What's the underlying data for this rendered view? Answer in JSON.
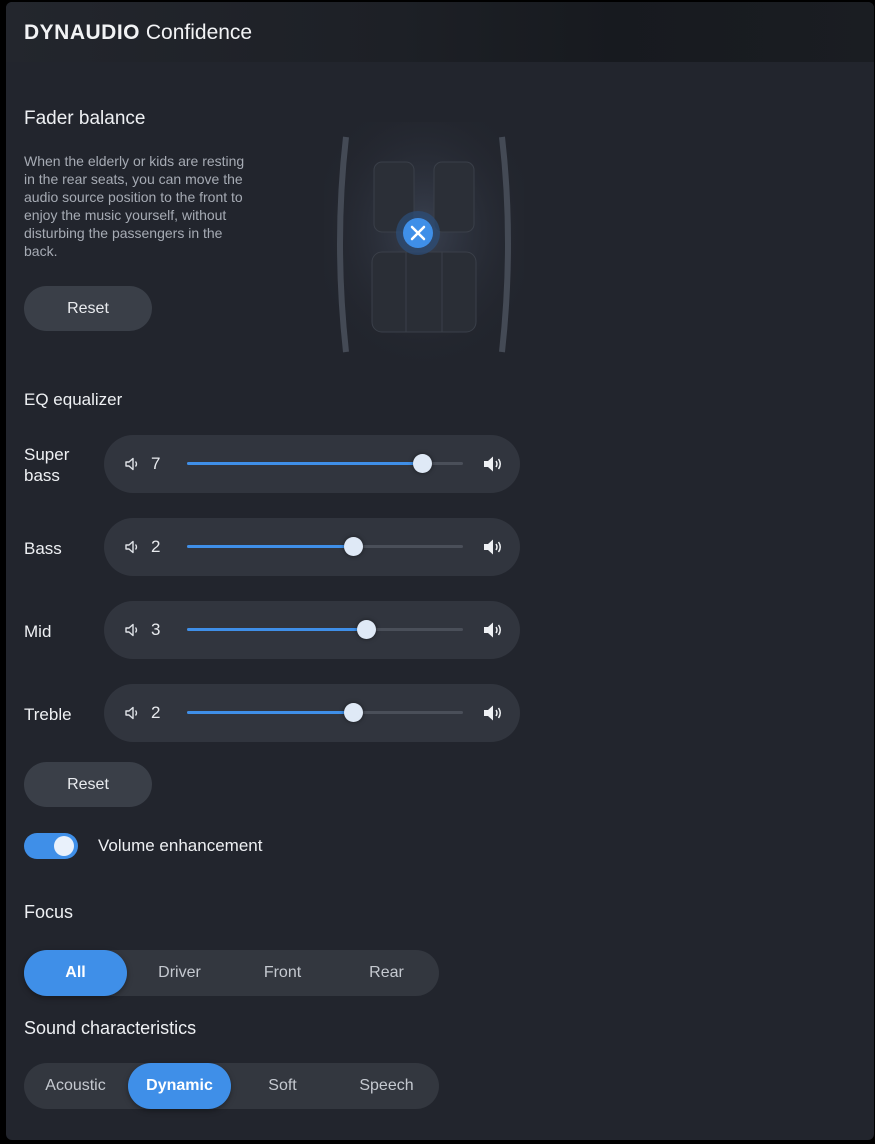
{
  "header": {
    "brand": "DYNAUDIO",
    "product": "Confidence"
  },
  "fader": {
    "title": "Fader balance",
    "description": "When the elderly or kids are resting in the rear seats, you can move the audio source position to the front to enjoy the music yourself, without disturbing the passengers in the back.",
    "reset_label": "Reset"
  },
  "eq": {
    "title": "EQ equalizer",
    "bands": [
      {
        "label": "Super bass",
        "value": "7",
        "level": 0.85
      },
      {
        "label": "Bass",
        "value": "2",
        "level": 0.6
      },
      {
        "label": "Mid",
        "value": "3",
        "level": 0.65
      },
      {
        "label": "Treble",
        "value": "2",
        "level": 0.6
      }
    ],
    "reset_label": "Reset"
  },
  "volume_enhancement": {
    "label": "Volume enhancement",
    "enabled": true
  },
  "focus": {
    "title": "Focus",
    "options": [
      "All",
      "Driver",
      "Front",
      "Rear"
    ],
    "selected": "All"
  },
  "sound": {
    "title": "Sound characteristics",
    "options": [
      "Acoustic",
      "Dynamic",
      "Soft",
      "Speech"
    ],
    "selected": "Dynamic"
  },
  "colors": {
    "accent": "#3f8fe8",
    "background": "#22252d",
    "pill": "#31353e"
  }
}
